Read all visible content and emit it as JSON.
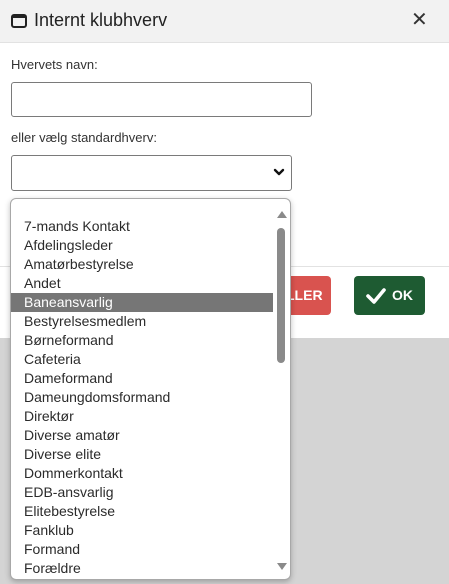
{
  "dialog": {
    "title": "Internt klubhverv",
    "name_label": "Hvervets navn:",
    "name_value": "",
    "standard_label": "eller vælg standardhverv:",
    "standard_selected": ""
  },
  "buttons": {
    "cancel_partial": "LLER",
    "ok_label": "OK"
  },
  "dropdown": {
    "selected_index": 4,
    "options": [
      "7-mands Kontakt",
      "Afdelingsleder",
      "Amatørbestyrelse",
      "Andet",
      "Baneansvarlig",
      "Bestyrelsesmedlem",
      "Børneformand",
      "Cafeteria",
      "Dameformand",
      "Dameungdomsformand",
      "Direktør",
      "Diverse amatør",
      "Diverse elite",
      "Dommerkontakt",
      "EDB-ansvarlig",
      "Elitebestyrelse",
      "Fanklub",
      "Formand",
      "Forældre"
    ]
  },
  "colors": {
    "cancel": "#d9534f",
    "ok": "#1e5b32",
    "selected_option": "#767676",
    "overlay": "#d4d4d4"
  },
  "icons": {
    "window": "window-icon",
    "close": "close-icon",
    "check": "check-icon",
    "select_arrow": "chevron-down-icon"
  }
}
